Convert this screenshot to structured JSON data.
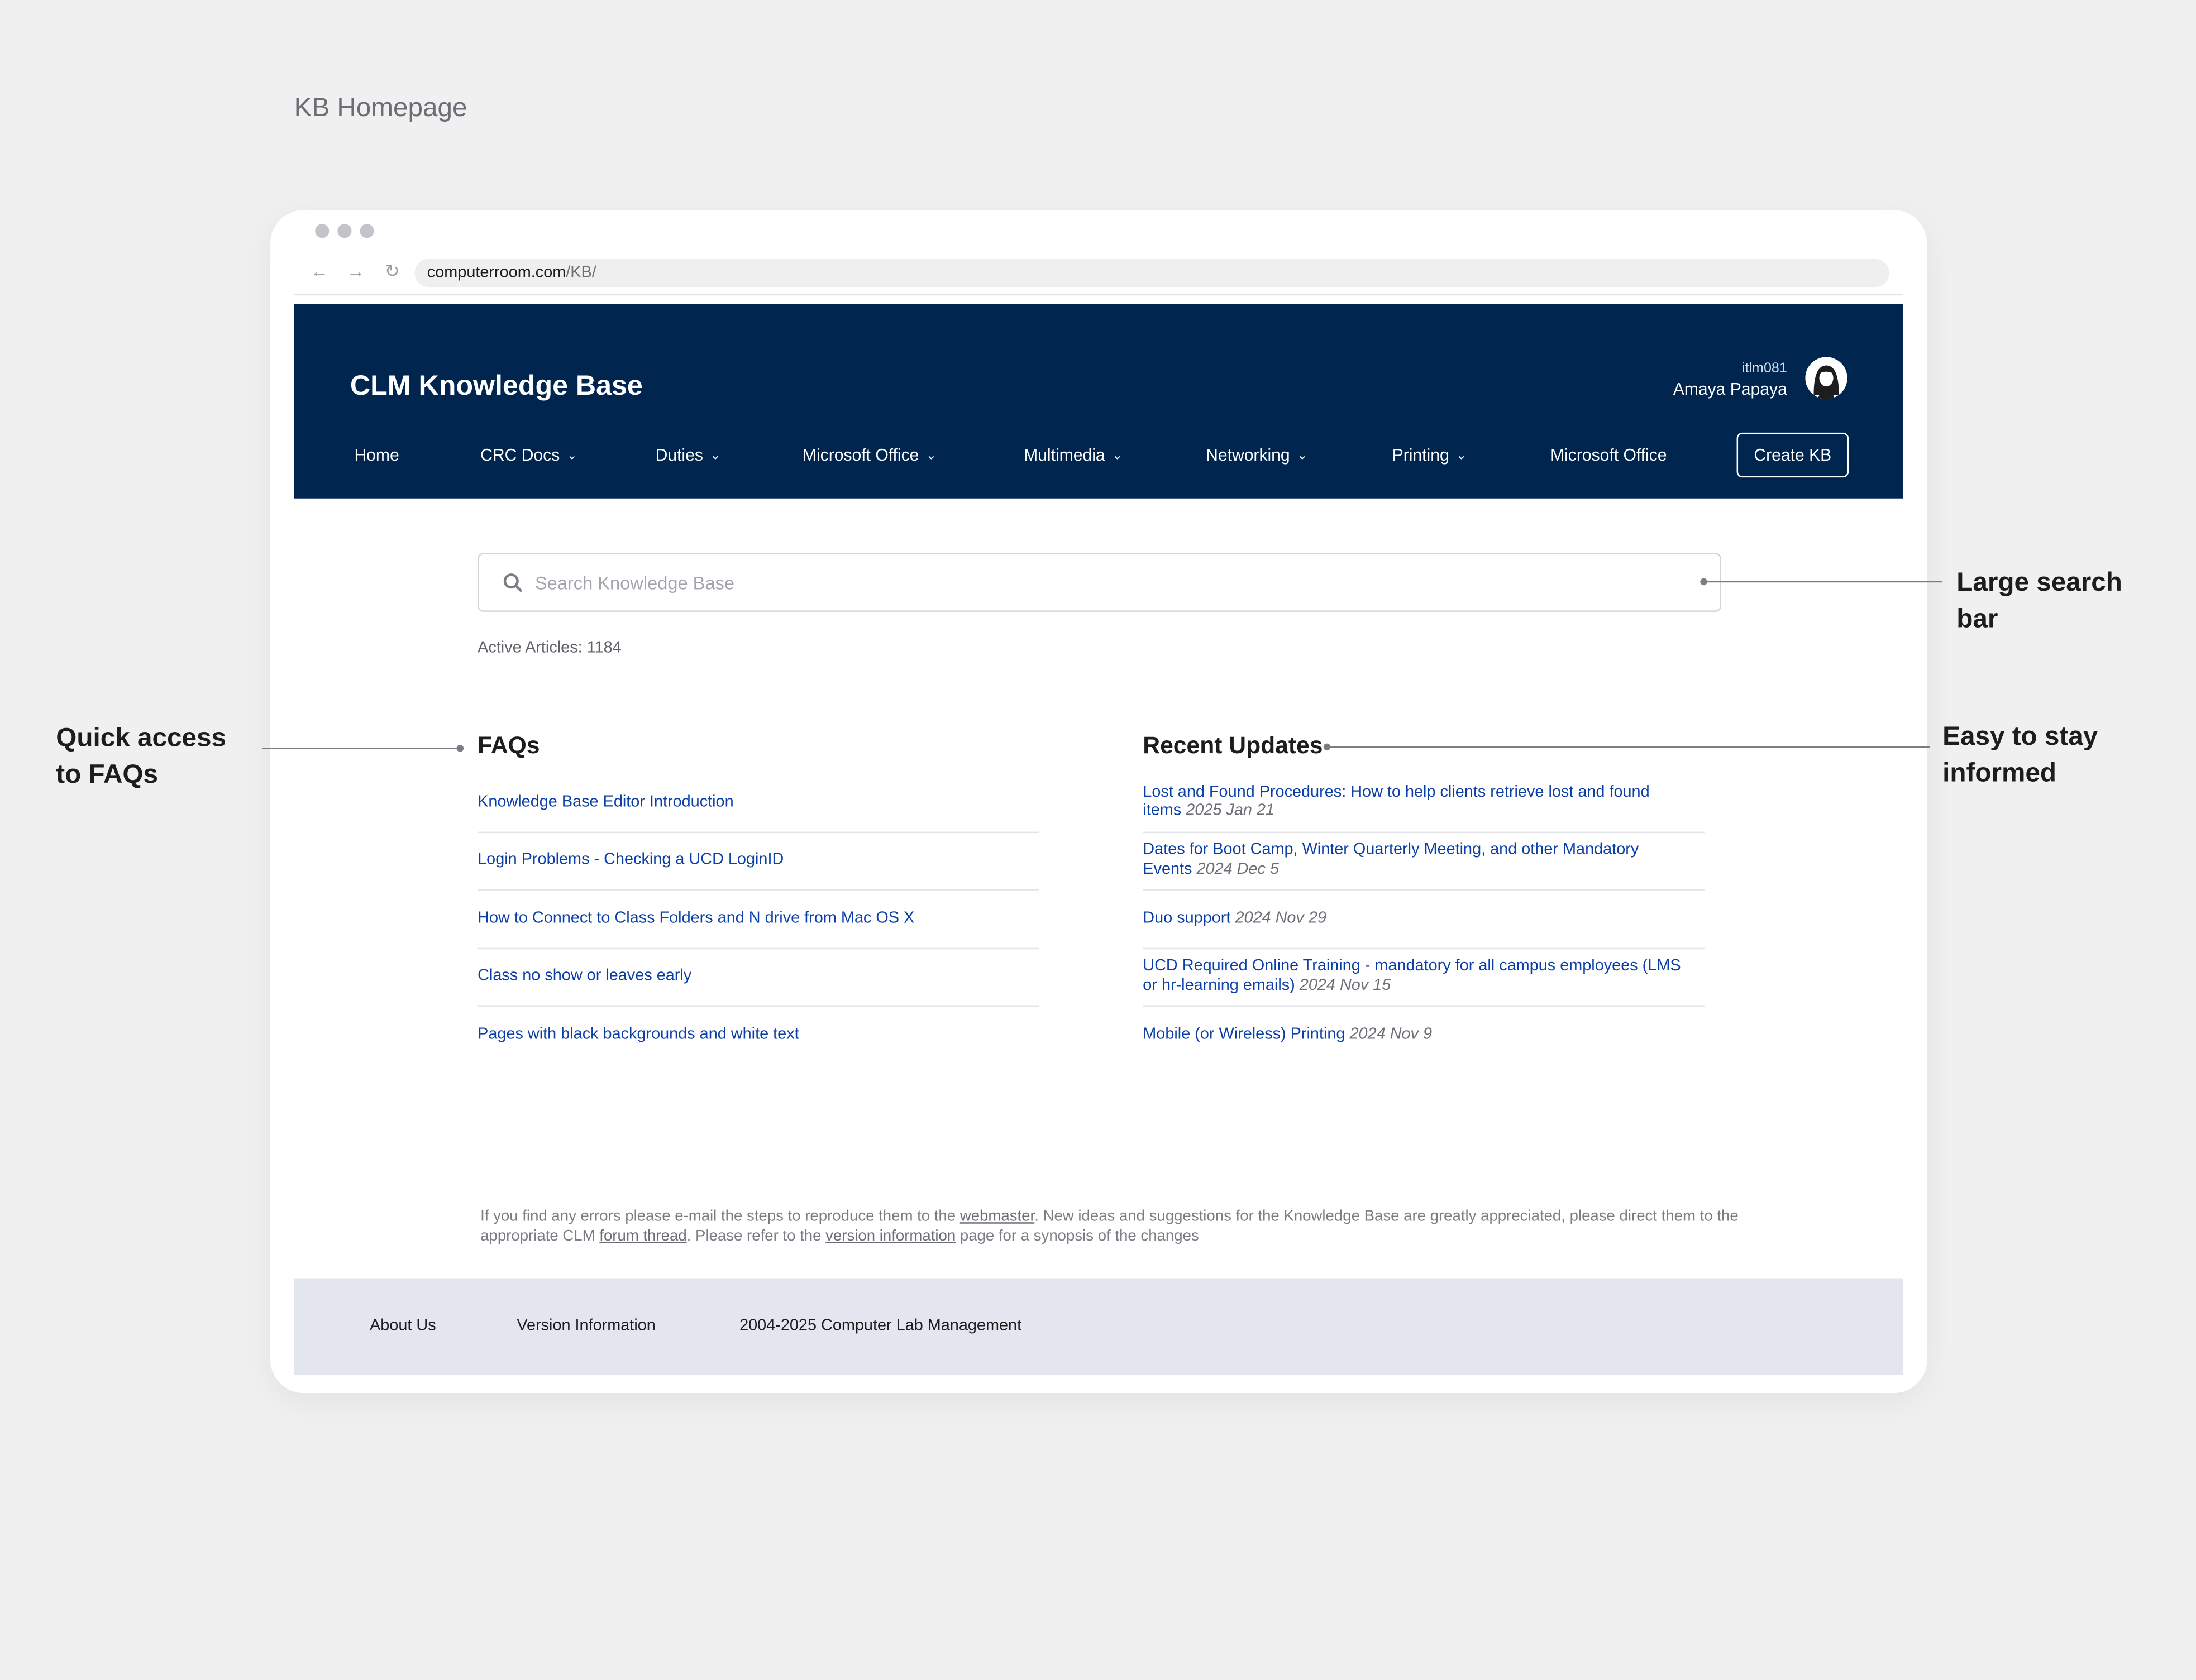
{
  "page_label": "KB Homepage",
  "browser": {
    "url_domain": "computerroom.com",
    "url_path": "/KB/",
    "back_icon": "←",
    "forward_icon": "→",
    "reload_icon": "↻"
  },
  "header": {
    "title": "CLM Knowledge Base",
    "user_id": "itlm081",
    "user_name": "Amaya Papaya",
    "bg_color": "#002650"
  },
  "nav": {
    "items": [
      {
        "label": "Home",
        "dropdown": false
      },
      {
        "label": "CRC Docs",
        "dropdown": true
      },
      {
        "label": "Duties",
        "dropdown": true
      },
      {
        "label": "Microsoft Office",
        "dropdown": true
      },
      {
        "label": "Multimedia",
        "dropdown": true
      },
      {
        "label": "Networking",
        "dropdown": true
      },
      {
        "label": "Printing",
        "dropdown": true
      },
      {
        "label": "Microsoft Office",
        "dropdown": false
      }
    ],
    "create_button": "Create KB"
  },
  "search": {
    "placeholder": "Search Knowledge Base",
    "active_articles": "Active Articles: 1184"
  },
  "faqs": {
    "title": "FAQs",
    "items": [
      "Knowledge Base Editor Introduction",
      "Login Problems - Checking a UCD LoginID",
      "How to Connect to Class Folders and N drive from Mac OS X",
      "Class no show or leaves early",
      "Pages with black backgrounds and white text"
    ]
  },
  "updates": {
    "title": "Recent Updates",
    "items": [
      {
        "title": "Lost and Found Procedures: How to help clients retrieve lost and found items",
        "date": "2025 Jan 21"
      },
      {
        "title": "Dates for Boot Camp, Winter Quarterly Meeting, and other Mandatory Events",
        "date": "2024 Dec 5"
      },
      {
        "title": "Duo support",
        "date": "2024 Nov 29"
      },
      {
        "title": "UCD Required Online Training - mandatory for all campus employees (LMS or hr-learning emails)",
        "date": "2024 Nov 15"
      },
      {
        "title": "Mobile (or Wireless) Printing",
        "date": "2024 Nov 9"
      }
    ]
  },
  "footnote": {
    "part1": "If you find any errors please e-mail the steps to reproduce them to the ",
    "link1": "webmaster",
    "part2": ". New ideas and suggestions for the Knowledge Base are greatly appreciated, please direct them to the appropriate CLM ",
    "link2": "forum thread",
    "part3": ". Please refer to the ",
    "link3": "version information",
    "part4": " page for a synopsis of the changes"
  },
  "footer": {
    "about": "About Us",
    "version": "Version Information",
    "copyright": "2004-2025 Computer Lab Management"
  },
  "annotations": {
    "search": "Large search bar",
    "faqs": "Quick access to FAQs",
    "updates": "Easy to stay informed"
  },
  "colors": {
    "link": "#0b3fa8",
    "footer_bg": "#e3e6ee",
    "page_bg": "#f0f0f0"
  }
}
